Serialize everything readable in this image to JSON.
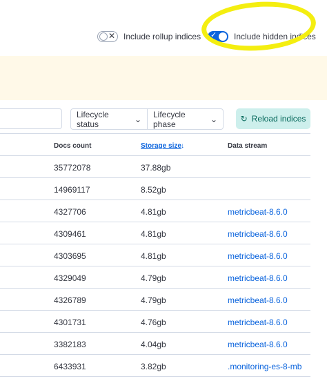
{
  "toggles": {
    "rollup": {
      "label": "Include rollup indices",
      "on": false
    },
    "hidden": {
      "label": "Include hidden indices",
      "on": true
    }
  },
  "filters": {
    "search_placeholder": "",
    "lifecycle_status": "Lifecycle status",
    "lifecycle_phase": "Lifecycle phase",
    "reload": "Reload indices"
  },
  "table": {
    "columns": {
      "docs_count": "Docs count",
      "storage_size": "Storage size",
      "data_stream": "Data stream"
    },
    "sort_column": "storage_size",
    "sort_direction": "descending",
    "rows": [
      {
        "docs_count": "35772078",
        "storage_size": "37.88gb",
        "data_stream": ""
      },
      {
        "docs_count": "14969117",
        "storage_size": "8.52gb",
        "data_stream": ""
      },
      {
        "docs_count": "4327706",
        "storage_size": "4.81gb",
        "data_stream": "metricbeat-8.6.0"
      },
      {
        "docs_count": "4309461",
        "storage_size": "4.81gb",
        "data_stream": "metricbeat-8.6.0"
      },
      {
        "docs_count": "4303695",
        "storage_size": "4.81gb",
        "data_stream": "metricbeat-8.6.0"
      },
      {
        "docs_count": "4329049",
        "storage_size": "4.79gb",
        "data_stream": "metricbeat-8.6.0"
      },
      {
        "docs_count": "4326789",
        "storage_size": "4.79gb",
        "data_stream": "metricbeat-8.6.0"
      },
      {
        "docs_count": "4301731",
        "storage_size": "4.76gb",
        "data_stream": "metricbeat-8.6.0"
      },
      {
        "docs_count": "3382183",
        "storage_size": "4.04gb",
        "data_stream": "metricbeat-8.6.0"
      },
      {
        "docs_count": "6433931",
        "storage_size": "3.82gb",
        "data_stream": ".monitoring-es-8-mb"
      }
    ]
  },
  "colors": {
    "accent": "#0b64dd",
    "reload_bg": "#cdefec",
    "callout_bg": "#fff9e8",
    "marker": "#f4ee10"
  },
  "icons": {
    "rollup_toggle": "cross-icon",
    "hidden_toggle": "check-icon",
    "reload": "refresh-icon",
    "sort": "arrow-down-icon",
    "dropdown": "chevron-down-icon"
  }
}
